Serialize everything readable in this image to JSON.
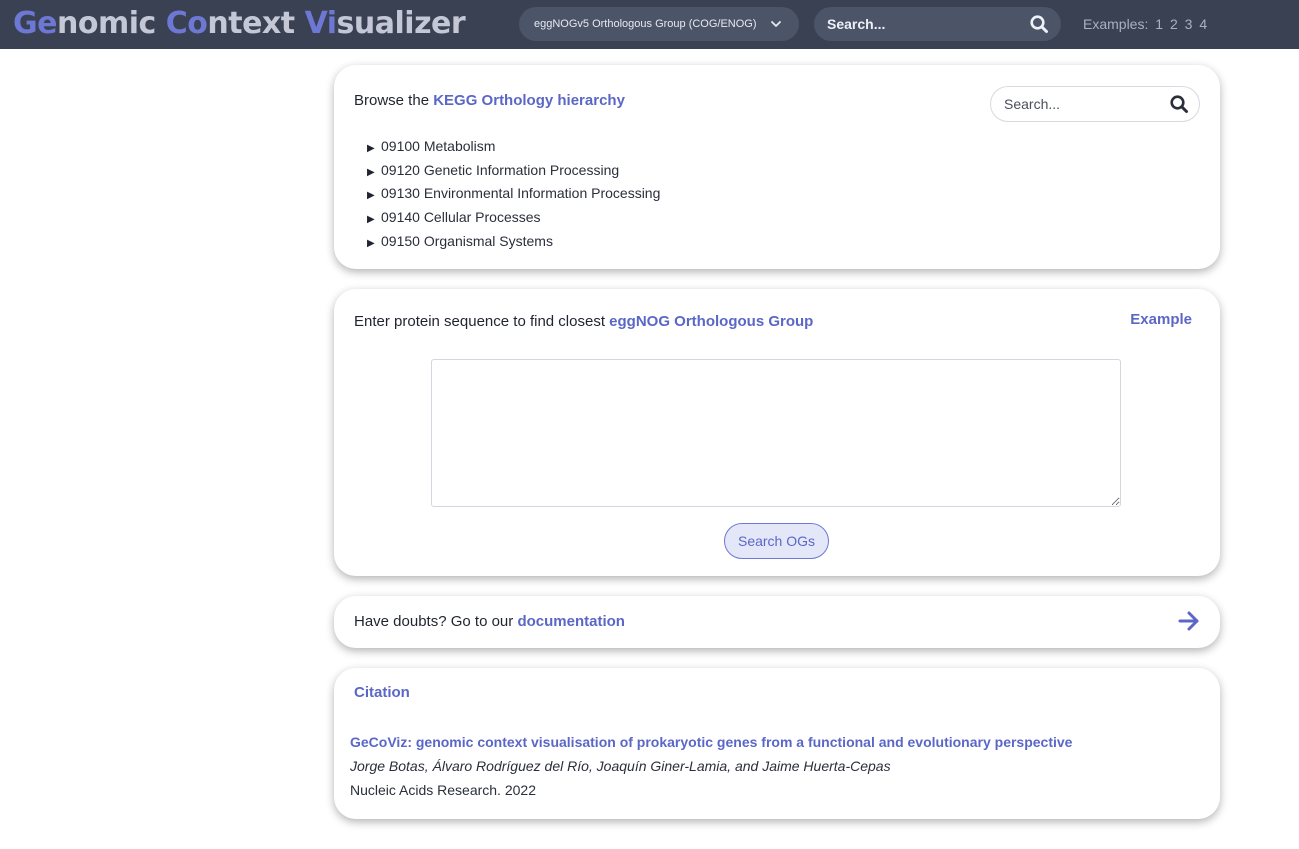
{
  "header": {
    "logo_parts": [
      {
        "text": "Ge",
        "highlight": true
      },
      {
        "text": "nomic ",
        "highlight": false
      },
      {
        "text": "Co",
        "highlight": true
      },
      {
        "text": "ntext ",
        "highlight": false
      },
      {
        "text": "Vi",
        "highlight": true
      },
      {
        "text": "sualizer",
        "highlight": false
      }
    ],
    "og_select": {
      "value": "eggNOGv5 Orthologous Group (COG/ENOG)",
      "icon": "chevron-down-icon"
    },
    "search": {
      "placeholder": "Search...",
      "icon": "search-icon"
    },
    "examples_label": "Examples:",
    "examples": [
      "1",
      "2",
      "3",
      "4"
    ]
  },
  "kegg": {
    "heading_prefix": "Browse the",
    "heading_link": "KEGG Orthology hierarchy",
    "search_placeholder": "Search...",
    "tree_marker": "▶",
    "tree": [
      "09100 Metabolism",
      "09120 Genetic Information Processing",
      "09130 Environmental Information Processing",
      "09140 Cellular Processes",
      "09150 Organismal Systems"
    ]
  },
  "sequence": {
    "heading_prefix": "Enter protein sequence to find closest",
    "heading_link": "eggNOG Orthologous Group",
    "example_label": "Example",
    "textarea_value": "",
    "button_label": "Search OGs"
  },
  "docs": {
    "text": "Have doubts? Go to our",
    "link": "documentation",
    "icon": "arrow-right-icon"
  },
  "citation": {
    "title": "Citation",
    "paper_title": "GeCoViz: genomic context visualisation of prokaryotic genes from a functional and evolutionary perspective",
    "authors": "Jorge Botas, Álvaro Rodríguez del Río, Joaquín Giner-Lamia, and Jaime Huerta-Cepas",
    "journal": "Nucleic Acids Research. 2022"
  },
  "colors": {
    "header_bg": "#3a4152",
    "accent": "#5b67c7",
    "logo_highlight": "#6d78d4",
    "logo_text": "#c4c8d6"
  }
}
